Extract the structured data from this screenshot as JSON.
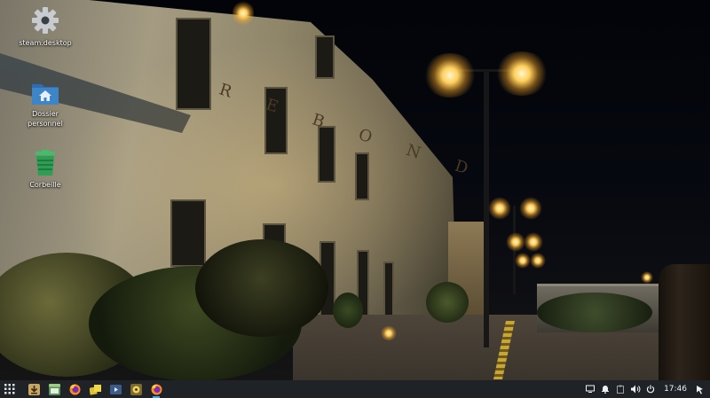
{
  "desktop": {
    "icons": [
      {
        "label": "steam.desktop",
        "icon": "gear-icon"
      },
      {
        "label": "Dossier personnel",
        "icon": "home-folder-icon"
      },
      {
        "label": "Corbeille",
        "icon": "trash-icon"
      }
    ]
  },
  "taskbar": {
    "launcher_icon": "app-grid-icon",
    "apps": [
      {
        "name": "installer",
        "icon": "installer-icon"
      },
      {
        "name": "window",
        "icon": "window-icon"
      },
      {
        "name": "firefox",
        "icon": "firefox-icon"
      },
      {
        "name": "files",
        "icon": "files-icon"
      },
      {
        "name": "media-player",
        "icon": "media-player-icon"
      },
      {
        "name": "music-player",
        "icon": "music-icon"
      },
      {
        "name": "firefox-running",
        "icon": "firefox-icon"
      }
    ],
    "tray": [
      {
        "icon": "display-icon"
      },
      {
        "icon": "notification-bell-icon"
      },
      {
        "icon": "clipboard-icon"
      },
      {
        "icon": "volume-icon"
      },
      {
        "icon": "power-icon"
      }
    ],
    "clock": "17:46",
    "show_desktop_icon": "show-desktop-icon"
  },
  "colors": {
    "taskbar_bg": "#1f2327",
    "accent": "#3daee9",
    "folder_blue": "#3d85c6",
    "trash_green": "#2e9e55"
  }
}
